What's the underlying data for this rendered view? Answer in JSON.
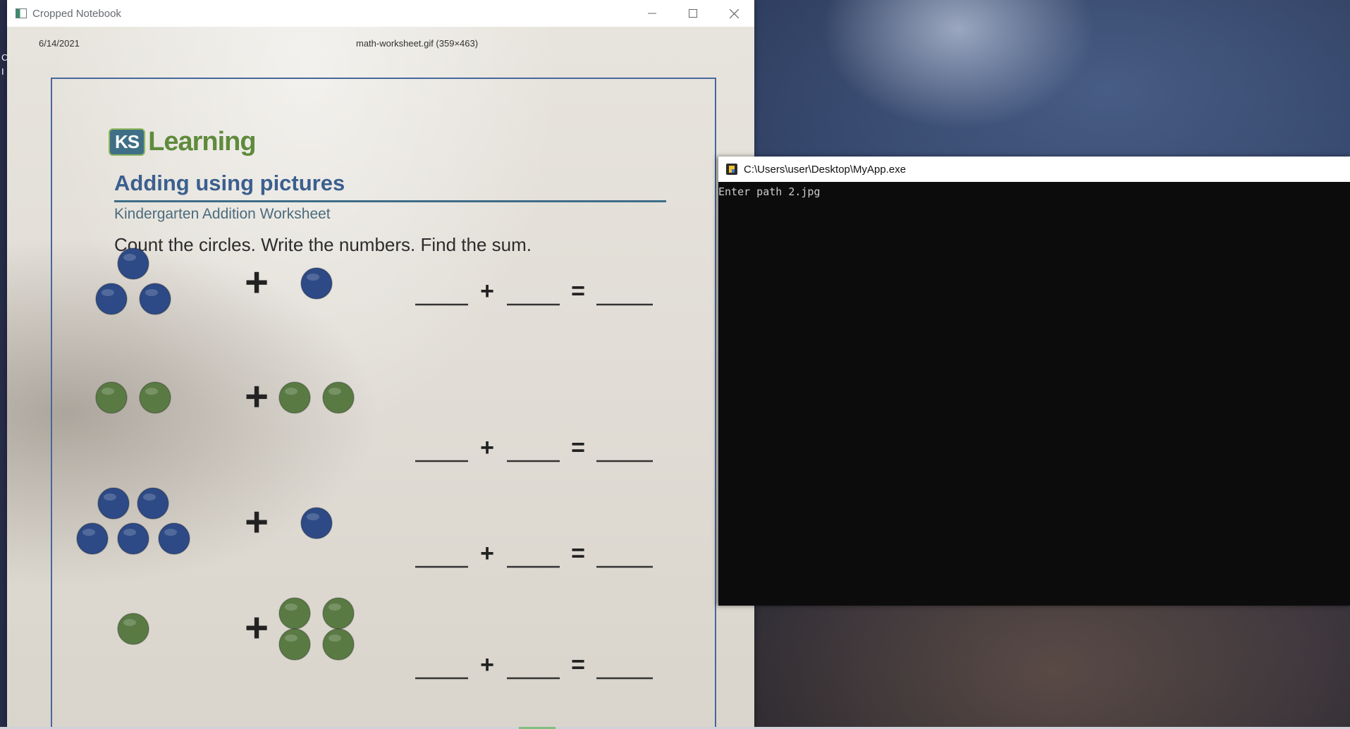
{
  "desktop": {
    "glyphs": [
      "C",
      "I"
    ]
  },
  "notebook_window": {
    "title": "Cropped Notebook",
    "controls": [
      "minimize",
      "maximize",
      "close"
    ],
    "header_date": "6/14/2021",
    "header_filename": "math-worksheet.gif (359×463)",
    "worksheet": {
      "logo_badge": "KS",
      "logo_word": "Learning",
      "title": "Adding using pictures",
      "subtitle": "Kindergarten Addition Worksheet",
      "instructions": "Count the circles. Write the numbers. Find the sum.",
      "plus_sign": "+",
      "equals_sign": "=",
      "problems": [
        {
          "left_count": 3,
          "right_count": 1,
          "color": "#2d4a86"
        },
        {
          "left_count": 2,
          "right_count": 2,
          "color": "#5a7a44"
        },
        {
          "left_count": 5,
          "right_count": 1,
          "color": "#2d4a86"
        },
        {
          "left_count": 1,
          "right_count": 4,
          "color": "#5a7a44"
        }
      ]
    }
  },
  "console_window": {
    "title": "C:\\Users\\user\\Desktop\\MyApp.exe",
    "output_line": "Enter path 2.jpg"
  }
}
